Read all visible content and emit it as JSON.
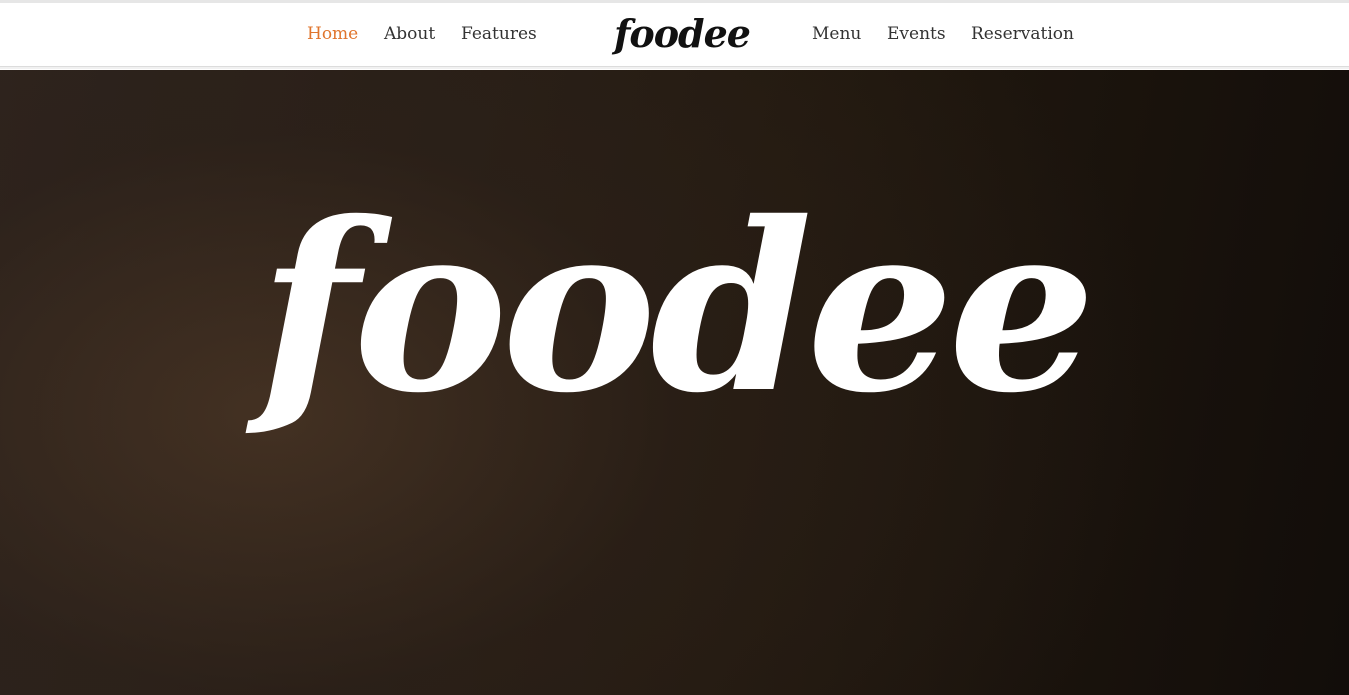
{
  "nav": {
    "left_items": [
      {
        "label": "Home",
        "active": true
      },
      {
        "label": "About",
        "active": false
      },
      {
        "label": "Features",
        "active": false
      }
    ],
    "brand": "foodee",
    "right_items": [
      {
        "label": "Menu",
        "active": false
      },
      {
        "label": "Events",
        "active": false
      },
      {
        "label": "Reservation",
        "active": false
      }
    ],
    "active_color": "#e0752d",
    "text_color": "#333333"
  },
  "hero": {
    "title": "foodee"
  }
}
